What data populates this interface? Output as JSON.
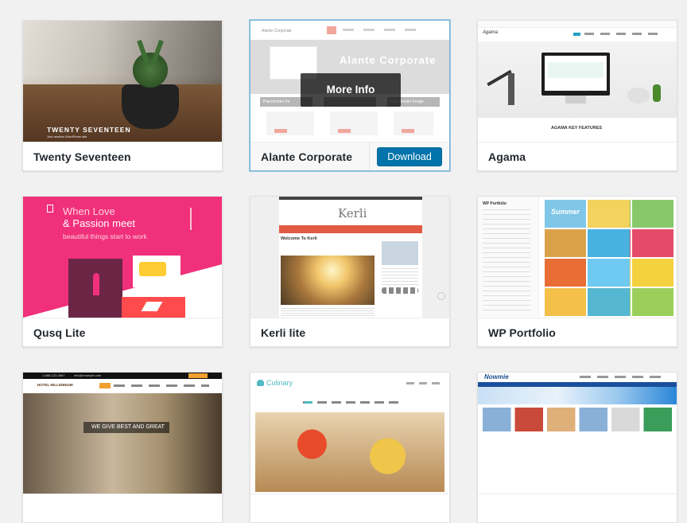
{
  "themes": [
    {
      "name": "Twenty Seventeen",
      "preview_title": "TWENTY SEVENTEEN",
      "preview_tagline": "Just another WordPress site"
    },
    {
      "name": "Alante Corporate",
      "overlay": "More Info",
      "button": "Download",
      "preview_brand": "Alante Corporate",
      "preview_hero": "Alante Corporate",
      "placeholders": [
        "Placeholder Im",
        "Placeholder Image"
      ]
    },
    {
      "name": "Agama",
      "preview_logo": "Agama",
      "preview_feature": "AGAMA KEY FEATURES"
    },
    {
      "name": "Qusq Lite",
      "hero_lines": [
        "When Love",
        "& Passion meet",
        "beautiful things start to work"
      ]
    },
    {
      "name": "Kerli lite",
      "preview_logo": "Kerli",
      "preview_post": "Welcome To Kerli"
    },
    {
      "name": "WP Portfolio",
      "sidebar_title": "WP Portfolio",
      "summer": "Summer"
    },
    {
      "name": "",
      "preview_logo": "HOTEL MILLENNIUM",
      "preview_text": "WE GIVE BEST AND GREAT",
      "preview_phone": "1-888-123-4567",
      "preview_email": "info@example.com"
    },
    {
      "name": "",
      "preview_logo": "Culinary"
    },
    {
      "name": "",
      "preview_logo": "Nowmie"
    }
  ],
  "colors": {
    "accent": "#0073aa",
    "qusq_pink": "#f0307a",
    "kerli_red": "#e05a44"
  }
}
